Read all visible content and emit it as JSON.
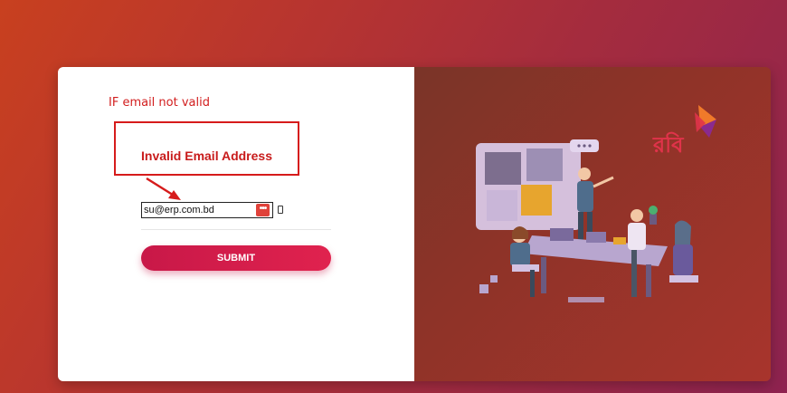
{
  "annotation": "IF email not valid",
  "error": {
    "message": "Invalid Email Address"
  },
  "form": {
    "email_value": "su@erp.com.bd",
    "password_manager_icon": "dots-icon",
    "submit_label": "SUBMIT"
  },
  "brand": {
    "logo_text": "রবি",
    "logo_icon": "robi-triangle-icon"
  },
  "colors": {
    "accent": "#d61b1b",
    "submit_start": "#c81848",
    "submit_end": "#e0224e",
    "logo_red": "#e0334a",
    "logo_orange": "#f07a2a",
    "logo_purple": "#8a2a8e"
  }
}
